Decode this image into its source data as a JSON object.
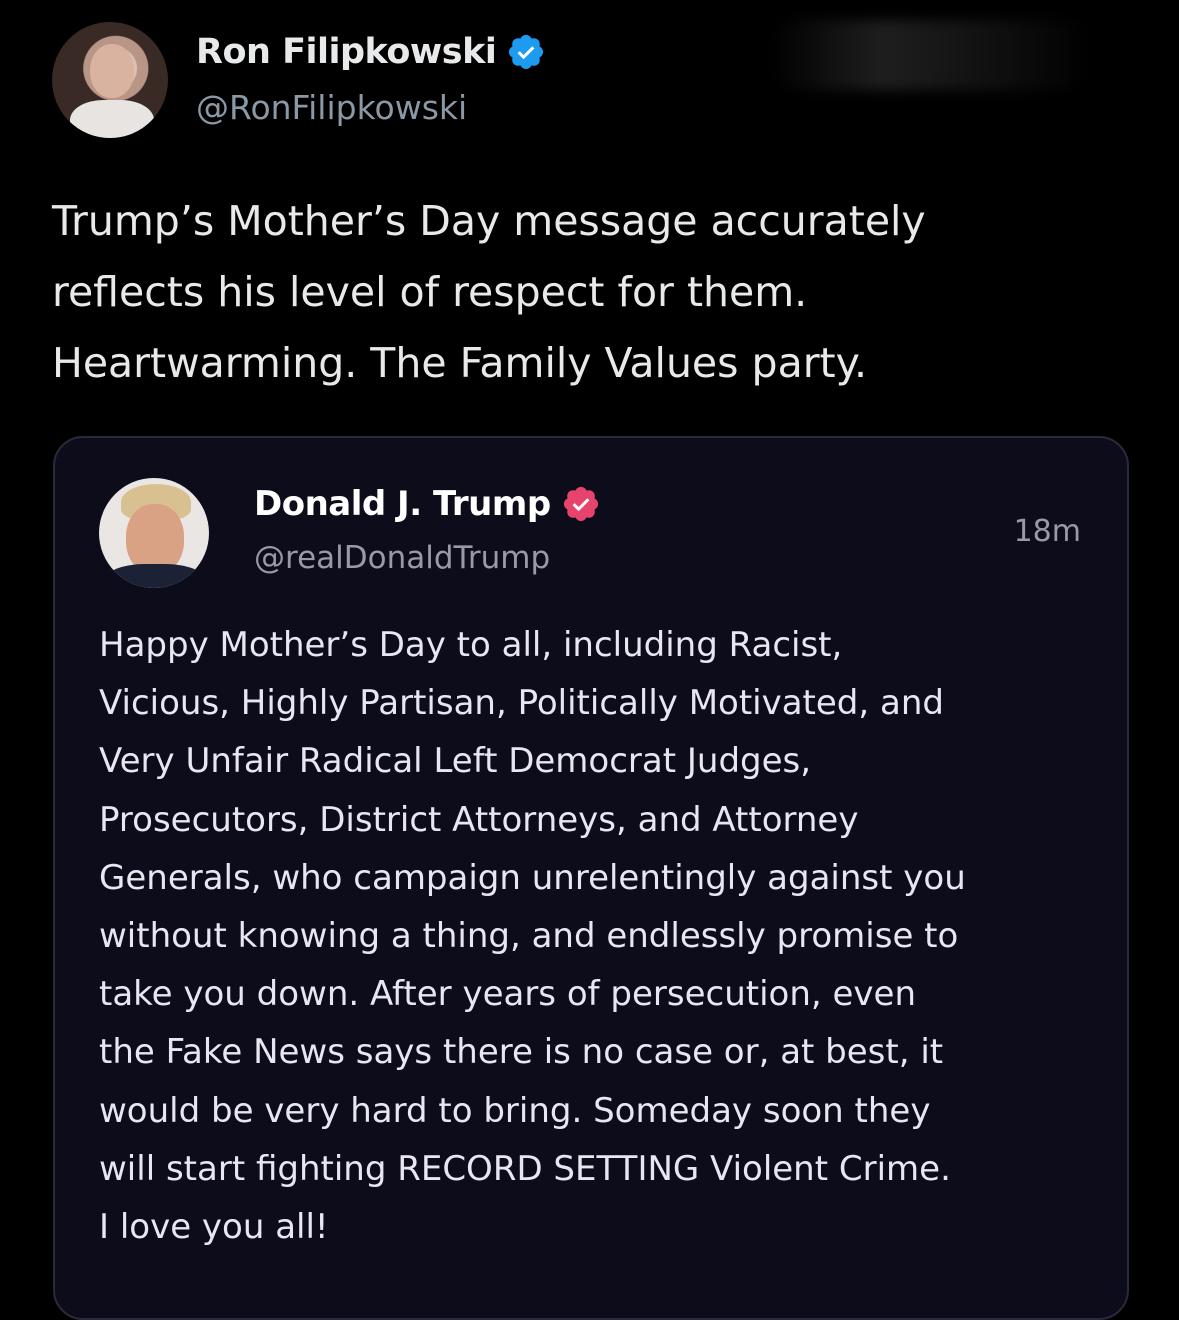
{
  "author": {
    "name": "Ron Filipkowski",
    "handle": "@RonFilipkowski",
    "verified_icon": "verified-badge-icon",
    "verified_color": "#1d9bf0"
  },
  "tweet": {
    "lines": [
      "Trump’s Mother’s Day message accurately",
      "reflects his level of respect for them.",
      "Heartwarming. The Family Values party."
    ]
  },
  "quoted": {
    "name": "Donald J. Trump",
    "handle": "@realDonaldTrump",
    "time": "18m",
    "badge_icon": "truth-verified-badge-icon",
    "badge_color": "#e6446d",
    "lines": [
      "Happy Mother’s Day to all, including Racist,",
      "Vicious, Highly Partisan, Politically Motivated, and",
      "Very Unfair Radical Left Democrat Judges,",
      "Prosecutors, District Attorneys, and Attorney",
      "Generals, who campaign unrelentingly against you",
      "without knowing a thing, and endlessly promise to",
      "take you down. After years of persecution, even",
      "the Fake News says there is no case or, at best, it",
      "would be very hard to bring. Someday soon they",
      "will start fighting RECORD SETTING Violent Crime.",
      "I love you all!"
    ]
  }
}
